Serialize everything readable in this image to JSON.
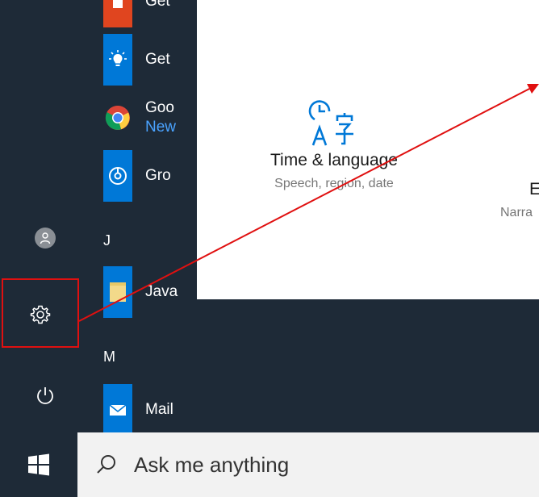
{
  "app_list": {
    "items": [
      {
        "label": "Get",
        "tile_color": "#e0451f",
        "icon": "office-icon"
      },
      {
        "label": "Get",
        "tile_color": "#0078d7",
        "icon": "lightbulb-icon"
      },
      {
        "label": "Goo",
        "sublabel": "New",
        "tile_color": "#1e2a37",
        "icon": "chrome-icon"
      },
      {
        "label": "Gro",
        "tile_color": "#0078d7",
        "icon": "groove-music-icon"
      },
      {
        "label": "Java",
        "tile_color": "#0078d7",
        "icon": "folder-icon"
      },
      {
        "label": "Mail",
        "tile_color": "#0078d7",
        "icon": "mail-icon"
      }
    ],
    "sections": [
      "J",
      "M"
    ]
  },
  "settings": {
    "tiles": [
      {
        "title": "Time & language",
        "desc": "Speech, region, date",
        "icon": "time-language-icon"
      },
      {
        "title": "E",
        "desc": "Narra",
        "icon": ""
      }
    ]
  },
  "taskbar": {
    "search_placeholder": "Ask me anything"
  },
  "colors": {
    "accent": "#0078d7",
    "annotation": "#e01010"
  }
}
